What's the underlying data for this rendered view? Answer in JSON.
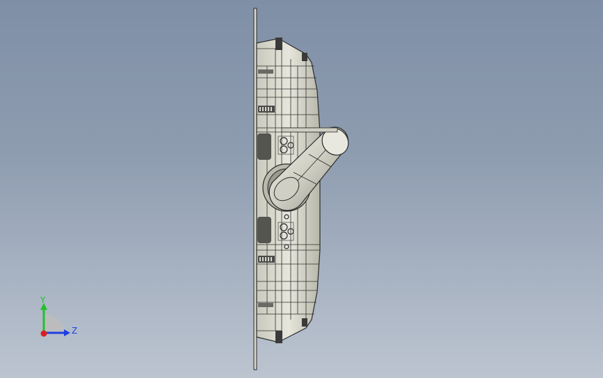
{
  "viewport": {
    "background_top": "#7f8fa6",
    "background_bottom": "#bcc4d0",
    "model_fill": "#d9d9cf",
    "model_edge": "#2a2a2a"
  },
  "triad": {
    "y_label": "Y",
    "z_label": "Z",
    "y_color": "#22c12a",
    "z_color": "#1f3fe0",
    "x_color": "#d91f1f"
  }
}
